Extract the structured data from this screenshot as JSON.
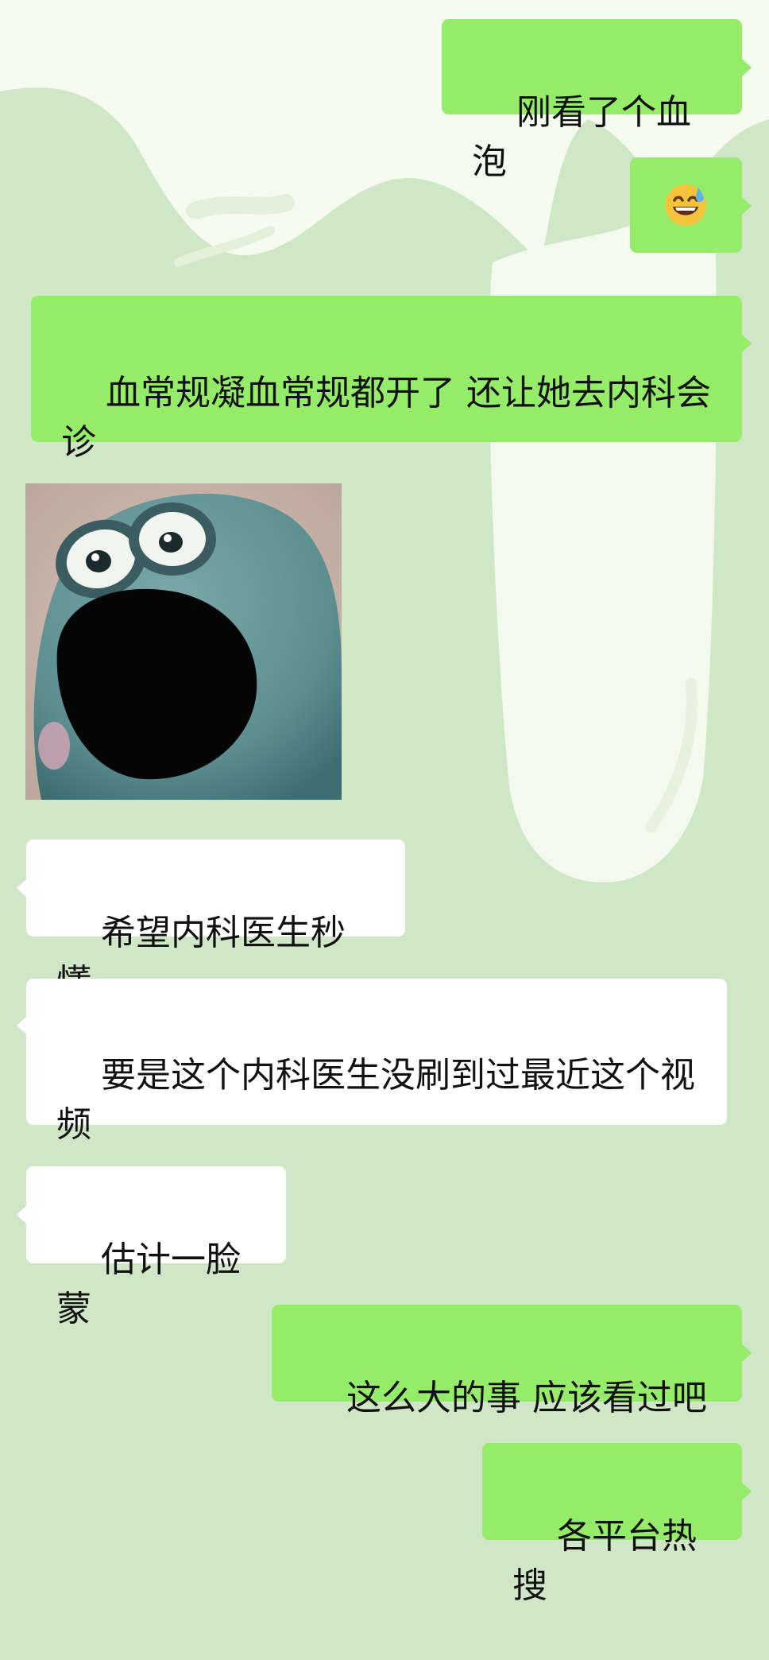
{
  "chat": {
    "messages": [
      {
        "side": "out",
        "type": "text",
        "text": "刚看了个血泡"
      },
      {
        "side": "out",
        "type": "emoji",
        "emoji": "grinning-face-with-sweat"
      },
      {
        "side": "out",
        "type": "text",
        "text": "血常规凝血常规都开了 还让她去内科会诊"
      },
      {
        "side": "in",
        "type": "sticker",
        "sticker": "screaming-green-creature"
      },
      {
        "side": "in",
        "type": "text",
        "text": "希望内科医生秒懂"
      },
      {
        "side": "in",
        "type": "text",
        "text": "要是这个内科医生没刷到过最近这个视频"
      },
      {
        "side": "in",
        "type": "text",
        "text": "估计一脸蒙"
      },
      {
        "side": "out",
        "type": "text",
        "text": "这么大的事 应该看过吧"
      },
      {
        "side": "out",
        "type": "text",
        "text": "各平台热搜"
      }
    ]
  },
  "colors": {
    "background": "#cfe7c6",
    "outgoing_bubble": "#95ec69",
    "incoming_bubble": "#ffffff",
    "text": "#111111"
  }
}
